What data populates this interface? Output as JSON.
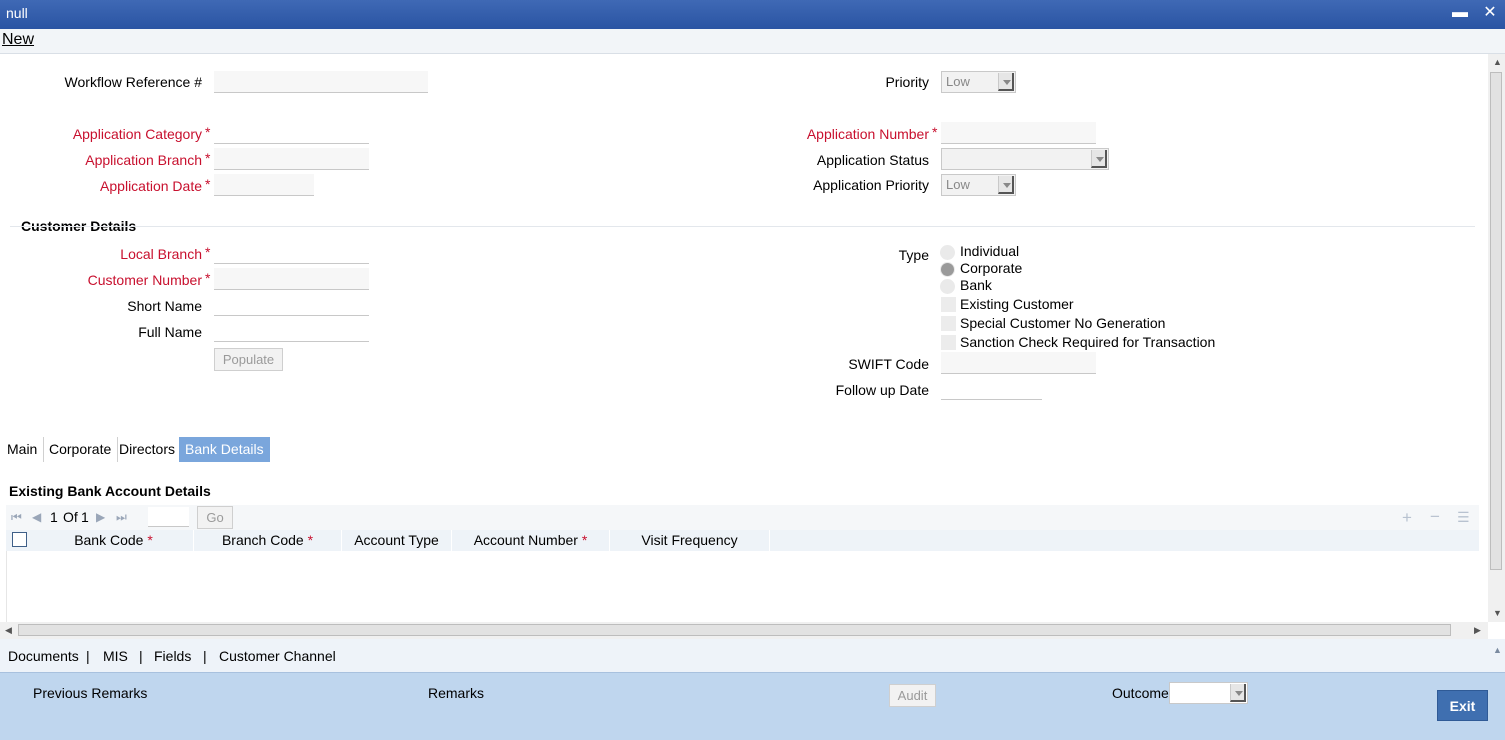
{
  "window": {
    "title": "null",
    "minimize": "▬",
    "close": "✕"
  },
  "menu": {
    "new": "New"
  },
  "form": {
    "workflow_ref_label": "Workflow Reference #",
    "priority_label": "Priority",
    "priority_value": "Low",
    "app_category_label": "Application Category",
    "app_branch_label": "Application Branch",
    "app_date_label": "Application Date",
    "app_number_label": "Application Number",
    "app_status_label": "Application Status",
    "app_priority_label": "Application Priority",
    "app_priority_value": "Low",
    "required_mark": "*"
  },
  "customer": {
    "section_title": "Customer Details",
    "local_branch_label": "Local Branch",
    "customer_number_label": "Customer Number",
    "short_name_label": "Short Name",
    "full_name_label": "Full Name",
    "populate_button": "Populate",
    "type_label": "Type",
    "type_options": [
      "Individual",
      "Corporate",
      "Bank"
    ],
    "type_selected": "Corporate",
    "checkboxes": [
      "Existing Customer",
      "Special Customer No Generation",
      "Sanction Check Required for Transaction"
    ],
    "swift_label": "SWIFT Code",
    "followup_label": "Follow up Date"
  },
  "tabs": [
    "Main",
    "Corporate",
    "Directors",
    "Bank Details"
  ],
  "active_tab": "Bank Details",
  "grid": {
    "section_title": "Existing Bank Account Details",
    "page_current": "1",
    "page_of": "Of",
    "page_total": "1",
    "go_button": "Go",
    "columns": [
      {
        "label": "Bank Code",
        "required": true
      },
      {
        "label": "Branch Code",
        "required": true
      },
      {
        "label": "Account Type",
        "required": false
      },
      {
        "label": "Account Number",
        "required": true
      },
      {
        "label": "Visit Frequency",
        "required": false
      }
    ]
  },
  "footer_links": [
    "Documents",
    "MIS",
    "Fields",
    "Customer Channel"
  ],
  "footer_sep": "|",
  "bottom": {
    "previous_remarks": "Previous Remarks",
    "remarks": "Remarks",
    "audit_button": "Audit",
    "outcome_label": "Outcome",
    "exit_button": "Exit"
  },
  "icons": {
    "first": "⏮",
    "prev": "◀",
    "next": "▶",
    "last": "⏭",
    "add": "+",
    "remove": "−",
    "list": "☰"
  }
}
